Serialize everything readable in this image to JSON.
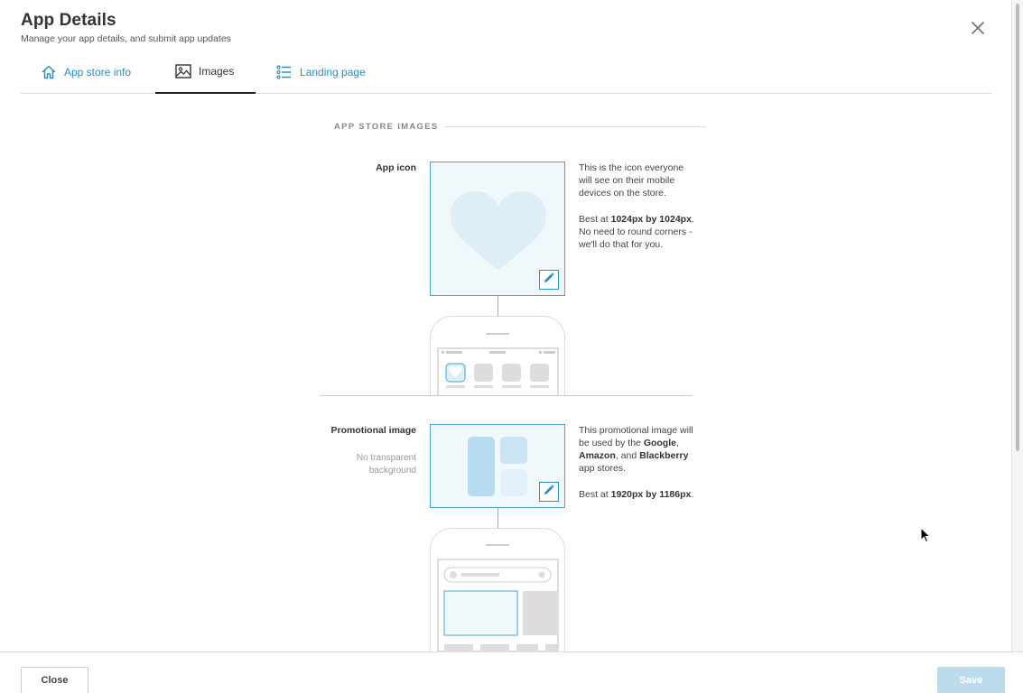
{
  "header": {
    "title": "App Details",
    "subtitle": "Manage your app details, and submit app updates",
    "close_icon": "close-icon"
  },
  "tabs": [
    {
      "label": "App store info",
      "icon": "home-icon",
      "active": false
    },
    {
      "label": "Images",
      "icon": "image-icon",
      "active": true
    },
    {
      "label": "Landing page",
      "icon": "list-icon",
      "active": false
    }
  ],
  "section": {
    "heading": "APP STORE IMAGES"
  },
  "app_icon": {
    "label": "App icon",
    "desc_line1": "This is the icon everyone will see on their mobile devices on the store.",
    "desc_best_prefix": "Best at ",
    "desc_best_size": "1024px by 1024px",
    "desc_best_suffix": ".",
    "desc_note": "No need to round corners - we'll do that for you."
  },
  "promo_image": {
    "label": "Promotional image",
    "sublabel": "No transparent background",
    "desc_prefix": "This promotional image will be used by the ",
    "store1": "Google",
    "sep1": ", ",
    "store2": "Amazon",
    "sep2": ", and ",
    "store3": "Blackberry",
    "desc_suffix": " app stores.",
    "desc_best_prefix": "Best at ",
    "desc_best_size": "1920px by 1186px",
    "desc_best_suffix": "."
  },
  "footer": {
    "close_label": "Close",
    "save_label": "Save"
  },
  "colors": {
    "accent": "#2a8fc4",
    "save_disabled": "#bcdcee",
    "image_bg": "#f1f8fc"
  }
}
